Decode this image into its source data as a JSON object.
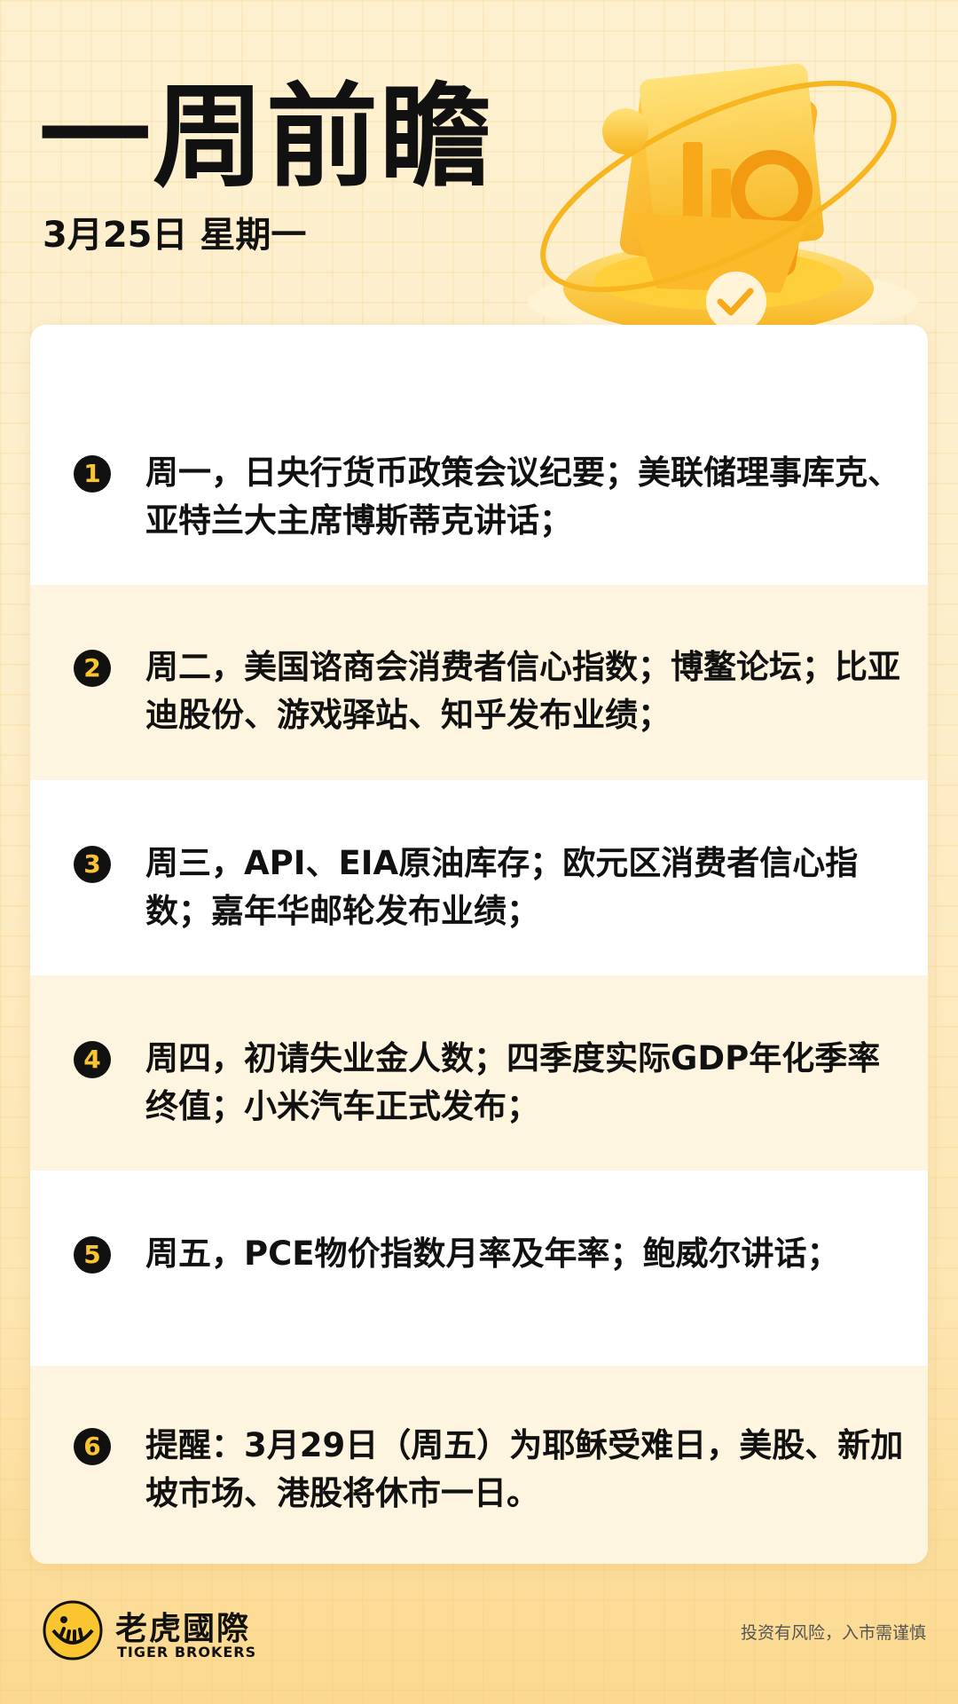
{
  "header": {
    "title": "一周前瞻",
    "date": "3月25日 星期一"
  },
  "items": [
    {
      "num": "1",
      "text": "周一，日央行货币政策会议纪要；美联储理事库克、亚特兰大主席博斯蒂克讲话；"
    },
    {
      "num": "2",
      "text": "周二，美国谘商会消费者信心指数；博鳌论坛；比亚迪股份、游戏驿站、知乎发布业绩；"
    },
    {
      "num": "3",
      "text": "周三，API、EIA原油库存；欧元区消费者信心指数；嘉年华邮轮发布业绩；"
    },
    {
      "num": "4",
      "text": "周四，初请失业金人数；四季度实际GDP年化季率终值；小米汽车正式发布；"
    },
    {
      "num": "5",
      "text": "周五，PCE物价指数月率及年率；鲍威尔讲话；"
    },
    {
      "num": "6",
      "text": "提醒：3月29日（周五）为耶稣受难日，美股、新加坡市场、港股将休市一日。"
    }
  ],
  "footer": {
    "brand_cn": "老虎國際",
    "brand_en": "TIGER BROKERS",
    "disclaimer": "投资有风险，入市需谨慎"
  },
  "colors": {
    "accent": "#fbc531",
    "background": "#fdeecb",
    "text": "#111111"
  }
}
